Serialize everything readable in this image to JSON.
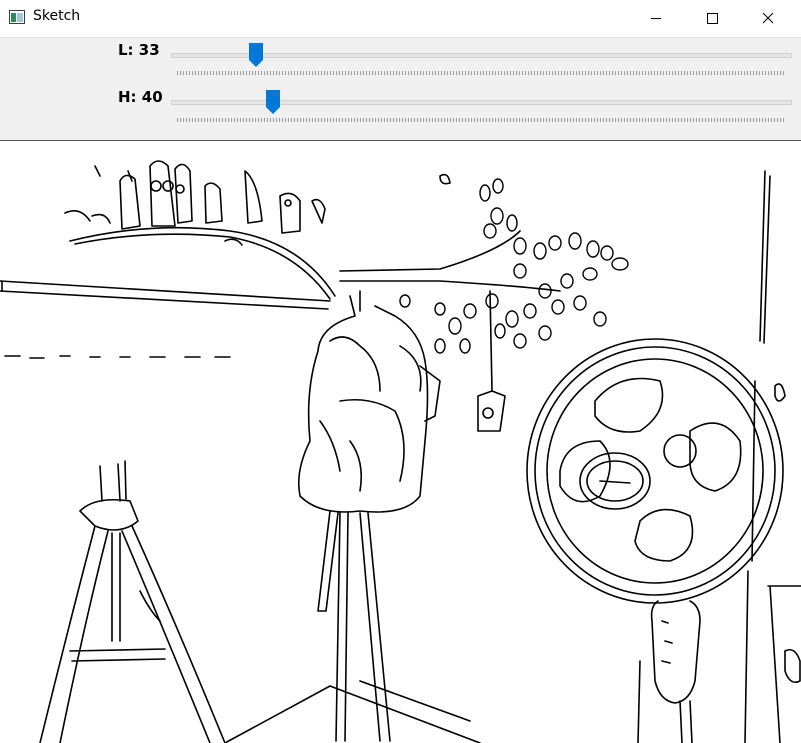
{
  "window": {
    "title": "Sketch",
    "icon": "app-window-icon",
    "controls": [
      "minimize-icon",
      "maximize-icon",
      "close-icon"
    ]
  },
  "sliders": [
    {
      "label": "L: 33",
      "value": 33,
      "max": 255
    },
    {
      "label": "H: 40",
      "value": 40,
      "max": 255
    }
  ],
  "colors": {
    "slider_thumb": "#0078d7",
    "panel_bg": "#f0f0f0",
    "canvas_bg": "#ffffff",
    "edge_lines": "#000000"
  }
}
